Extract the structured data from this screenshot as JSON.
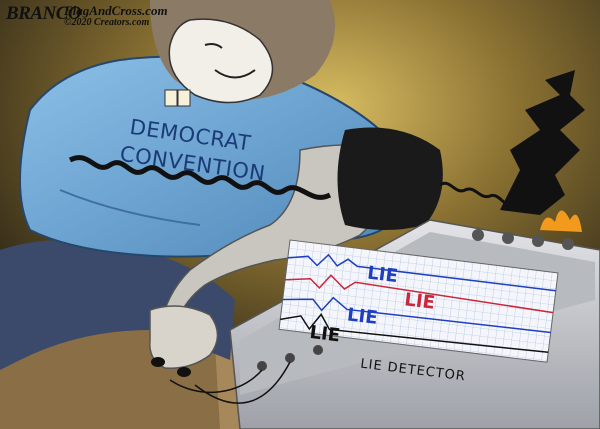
{
  "credit": {
    "artist": "BRANCO",
    "site": "FlagAndCross.com",
    "copyright": "©2020 Creators.com"
  },
  "shirt": {
    "line1": "DEMOCRAT",
    "line2": "CONVENTION"
  },
  "device": {
    "label": "LIE DETECTOR",
    "chart_traces": [
      {
        "text": "LIE",
        "color": "#1f3fbf"
      },
      {
        "text": "LIE",
        "color": "#c8283a"
      },
      {
        "text": "LIE",
        "color": "#1f3fbf"
      },
      {
        "text": "LIE",
        "color": "#111111"
      }
    ]
  },
  "colors": {
    "background_dark": "#2a2416",
    "background_glow": "#c9a94e",
    "shirt": "#6aa7d9",
    "pants": "#3b4a6a",
    "machine": "#c9cbd0",
    "flame": "#f29a1d"
  }
}
